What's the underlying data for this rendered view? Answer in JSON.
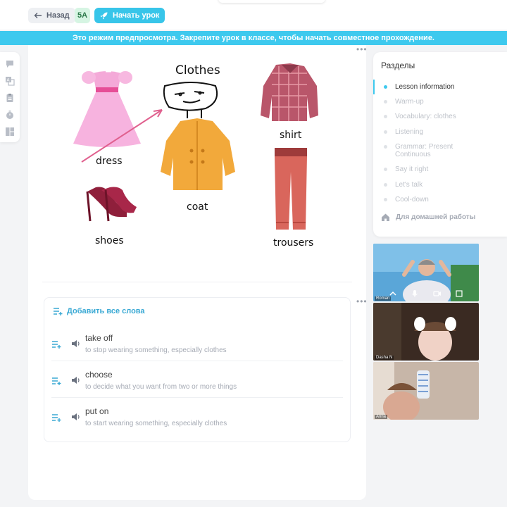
{
  "header": {
    "back_label": "Назад",
    "class_badge": "5A",
    "start_label": "Начать урок"
  },
  "banner": {
    "text": "Это режим предпросмотра. Закрепите урок в классе, чтобы начать совместное прохождение."
  },
  "tools": [
    "chat-icon",
    "translate-icon",
    "clipboard-icon",
    "timer-icon",
    "layout-icon"
  ],
  "image": {
    "title": "Clothes",
    "labels": {
      "dress": "dress",
      "coat": "coat",
      "shirt": "shirt",
      "shoes": "shoes",
      "trousers": "trousers"
    }
  },
  "words": {
    "add_all_label": "Добавить все слова",
    "items": [
      {
        "term": "take off",
        "definition": "to stop wearing something, especially clothes"
      },
      {
        "term": "choose",
        "definition": "to decide what you want from two or more things"
      },
      {
        "term": "put on",
        "definition": "to start wearing something, especially clothes"
      }
    ]
  },
  "sections": {
    "title": "Разделы",
    "items": [
      {
        "label": "Lesson information",
        "active": true
      },
      {
        "label": "Warm-up"
      },
      {
        "label": "Vocabulary: clothes"
      },
      {
        "label": "Listening"
      },
      {
        "label": "Grammar: Present Continuous"
      },
      {
        "label": "Say it right"
      },
      {
        "label": "Let's talk"
      },
      {
        "label": "Cool-down"
      }
    ],
    "homework_label": "Для домашней работы"
  },
  "videos": [
    {
      "name": "Roman"
    },
    {
      "name": "Dasha N"
    },
    {
      "name": "Anna"
    }
  ],
  "colors": {
    "accent": "#3ec9ee",
    "start_button": "#38c5e9",
    "badge_bg": "#d6f5e3"
  }
}
